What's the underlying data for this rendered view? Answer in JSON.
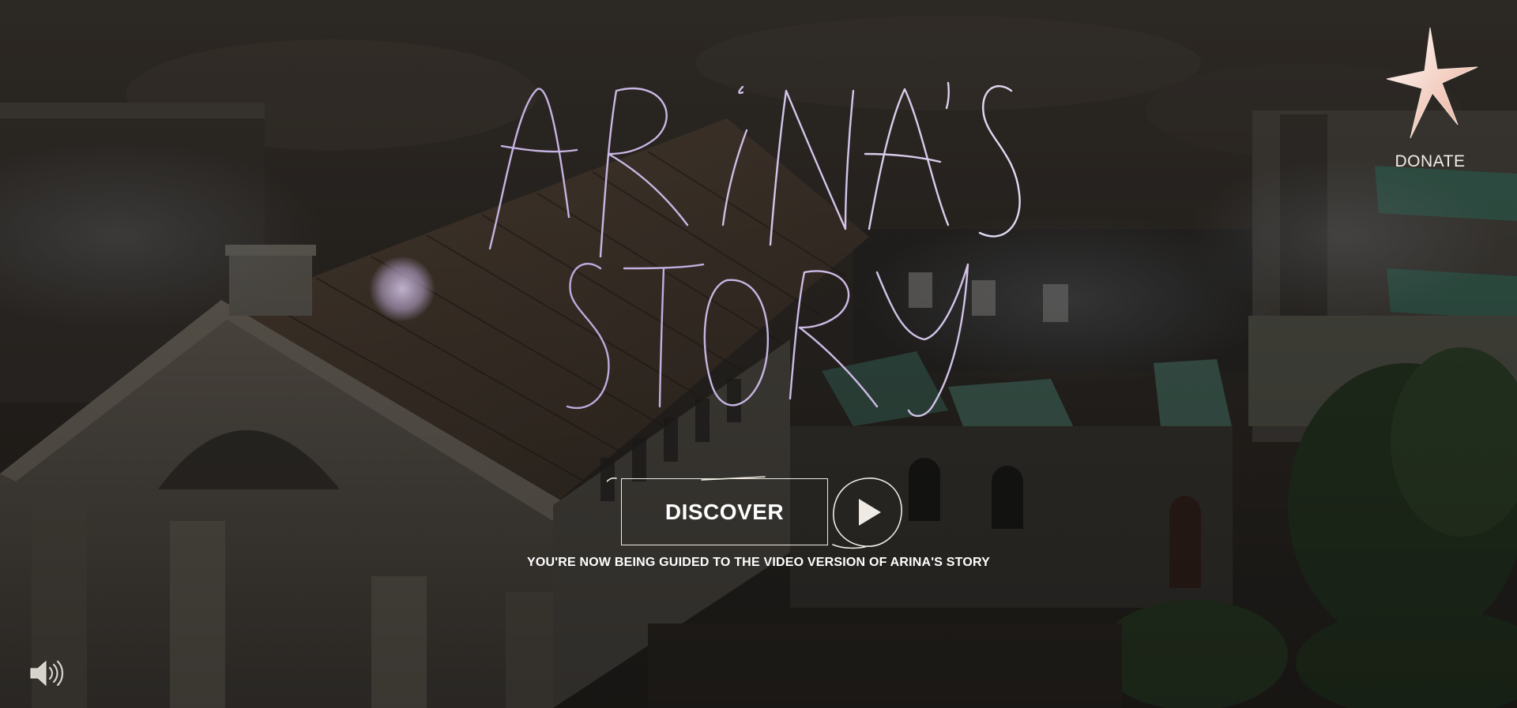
{
  "page": {
    "title_line1": "ARINA'S",
    "title_line2": "STORY"
  },
  "donate": {
    "label": "DONATE",
    "icon": "star-icon"
  },
  "cta": {
    "discover_label": "DISCOVER",
    "play_icon": "play-icon",
    "guide_text": "YOU'RE NOW BEING GUIDED TO THE VIDEO VERSION OF ARINA'S STORY"
  },
  "controls": {
    "sound_icon": "speaker-icon"
  },
  "colors": {
    "title": "#c9b6e4",
    "accent_star": "#f3d4c4",
    "text": "#ffffff"
  }
}
